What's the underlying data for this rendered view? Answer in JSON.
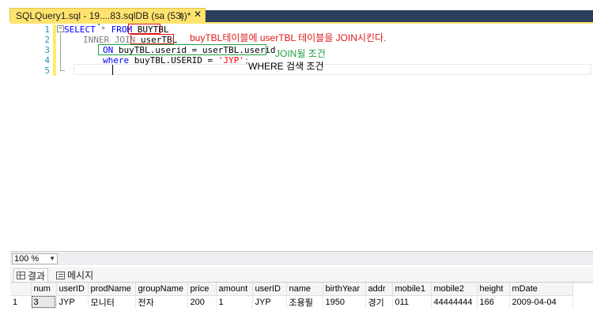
{
  "tab": {
    "title": "SQLQuery1.sql - 19....83.sqlDB (sa (53))*",
    "pin_icon": "pin-icon",
    "close_icon": "close-icon"
  },
  "editor": {
    "line_numbers": [
      "1",
      "2",
      "3",
      "4",
      "5"
    ],
    "lines": {
      "l1_kw": "SELECT",
      "l1_op": " * ",
      "l1_kw2": "FROM ",
      "l1_table": "BUYTBL",
      "l2_kw": "INNER JOIN ",
      "l2_table": "userTBL",
      "l3_kw": "ON ",
      "l3_expr": "buyTBL.userid = userTBL.userid",
      "l4_kw": "where ",
      "l4_expr": "buyTBL.USERID = ",
      "l4_str": "'JYP'",
      "l4_end": ";"
    },
    "annotations": {
      "join_note": "buyTBL테이블에 userTBL 테이블을 JOIN시킨다.",
      "join_condition": "JOIN될 조건",
      "where_condition": "WHERE 검색 조건"
    },
    "colors": {
      "keyword": "#0000ff",
      "string": "#ff0000",
      "annotation_red": "#e01a1a",
      "annotation_green": "#1fa040",
      "tab_active": "#ffe36e"
    }
  },
  "status": {
    "zoom": "100 %"
  },
  "results_tabs": [
    {
      "label": "결과",
      "icon": "grid-icon"
    },
    {
      "label": "메시지",
      "icon": "message-icon"
    }
  ],
  "grid": {
    "columns": [
      "num",
      "userID",
      "prodName",
      "groupName",
      "price",
      "amount",
      "userID",
      "name",
      "birthYear",
      "addr",
      "mobile1",
      "mobile2",
      "height",
      "mDate"
    ],
    "rows": [
      {
        "rownum": "1",
        "cells": [
          "3",
          "JYP",
          "모니터",
          "전자",
          "200",
          "1",
          "JYP",
          "조용필",
          "1950",
          "경기",
          "011",
          "44444444",
          "166",
          "2009-04-04"
        ]
      }
    ]
  }
}
